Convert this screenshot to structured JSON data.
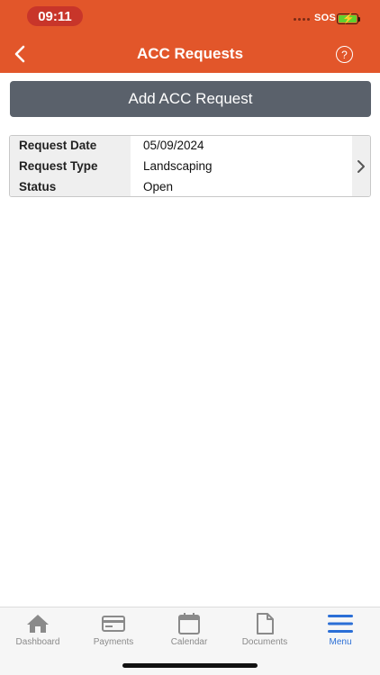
{
  "status_bar": {
    "time": "09:11",
    "carrier": "SOS"
  },
  "header": {
    "title": "ACC Requests",
    "help_symbol": "?",
    "back_icon": "chevron-left-icon",
    "help_icon": "help-circle-icon"
  },
  "colors": {
    "header_bg": "#e2562a",
    "button_bg": "#5a616b",
    "active_tab": "#2b6fd6",
    "inactive_tab": "#8a8a8a"
  },
  "add_button": {
    "label": "Add ACC Request"
  },
  "request": {
    "rows": [
      {
        "label": "Request Date",
        "value": "05/09/2024"
      },
      {
        "label": "Request Type",
        "value": "Landscaping"
      },
      {
        "label": "Status",
        "value": "Open"
      }
    ]
  },
  "tabs": [
    {
      "label": "Dashboard",
      "icon": "home-icon",
      "active": false
    },
    {
      "label": "Payments",
      "icon": "credit-card-icon",
      "active": false
    },
    {
      "label": "Calendar",
      "icon": "calendar-icon",
      "active": false
    },
    {
      "label": "Documents",
      "icon": "document-icon",
      "active": false
    },
    {
      "label": "Menu",
      "icon": "menu-icon",
      "active": true
    }
  ]
}
